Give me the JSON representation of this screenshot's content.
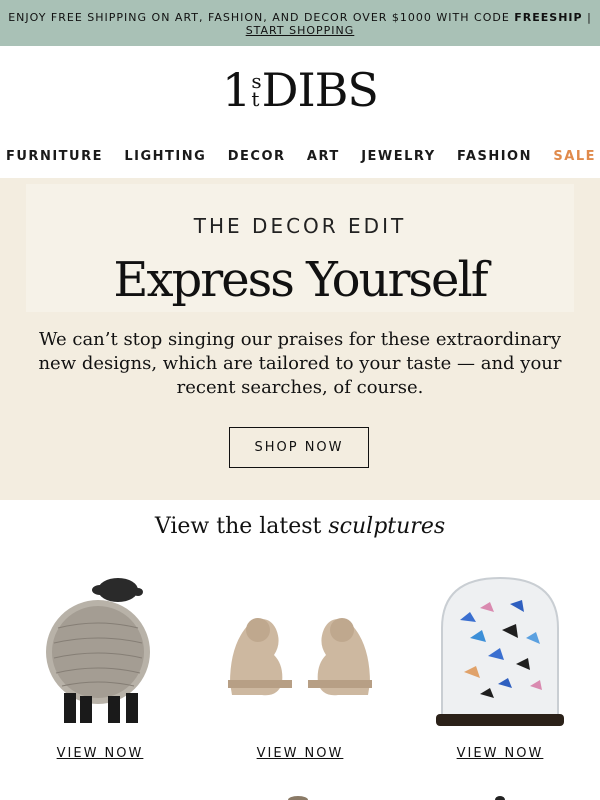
{
  "promo": {
    "text_before": "ENJOY FREE SHIPPING ON ART, FASHION, AND DECOR OVER $1000 WITH CODE ",
    "code": "FREESHIP",
    "separator": " |",
    "link_label": "START SHOPPING"
  },
  "brand": {
    "one": "1",
    "st": "st",
    "dibs": "DIBS"
  },
  "nav": {
    "items": [
      "FURNITURE",
      "LIGHTING",
      "DECOR",
      "ART",
      "JEWELRY",
      "FASHION"
    ],
    "sale": "SALE",
    "sale_color": "#e08a4b"
  },
  "hero": {
    "eyebrow": "THE DECOR EDIT",
    "headline": "Express Yourself",
    "body": "We can’t stop singing our praises for these extraordinary new designs, which are tailored to your taste — and your recent searches, of course.",
    "cta": "SHOP NOW",
    "background": "#f3ede0"
  },
  "latest": {
    "prefix": "View the latest ",
    "emphasis": "sculptures"
  },
  "products": [
    {
      "image": "sheep-sculpture",
      "cta": "VIEW NOW"
    },
    {
      "image": "ram-pair-sculpture",
      "cta": "VIEW NOW"
    },
    {
      "image": "butterfly-dome",
      "cta": "VIEW NOW"
    }
  ]
}
